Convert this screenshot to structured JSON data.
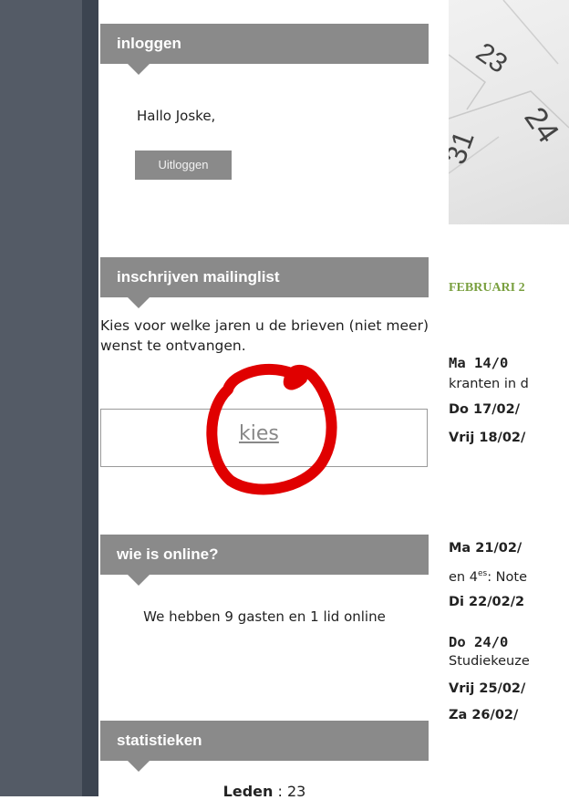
{
  "sidebar": {
    "login": {
      "header": "inloggen",
      "greeting": "Hallo Joske,",
      "logout_label": "Uitloggen"
    },
    "mailing": {
      "header": "inschrijven mailinglist",
      "description": "Kies voor welke jaren u de brieven (niet meer) wenst te ontvangen.",
      "choose_label": "kies"
    },
    "online": {
      "header": "wie is online?",
      "text": "We hebben 9 gasten en 1 lid online"
    },
    "stats": {
      "header": "statistieken",
      "first_label": "Leden",
      "first_value": ": 23"
    }
  },
  "content": {
    "month_title": "FEBRUARI 2",
    "events": [
      {
        "text": "Ma   14/0"
      },
      {
        "text": "kranten in d"
      },
      {
        "text": "Do 17/02/"
      },
      {
        "text": "Vrij 18/02/"
      },
      {
        "text": "Ma 21/02/"
      },
      {
        "text": "en 4"
      },
      {
        "sup": "es"
      },
      {
        "text": ": Note"
      },
      {
        "text": "Di 22/02/2"
      },
      {
        "text": "Do   24/0"
      },
      {
        "text": "Studiekeuze"
      },
      {
        "text": "Vrij 25/02/"
      },
      {
        "text": "Za 26/02/"
      }
    ]
  },
  "colors": {
    "sidebar_dark": "#545b66",
    "module_header": "#8a8a8a",
    "month_title": "#7aa040",
    "annotation": "#e00000"
  },
  "hero_numbers": [
    "23",
    "24",
    "31"
  ]
}
